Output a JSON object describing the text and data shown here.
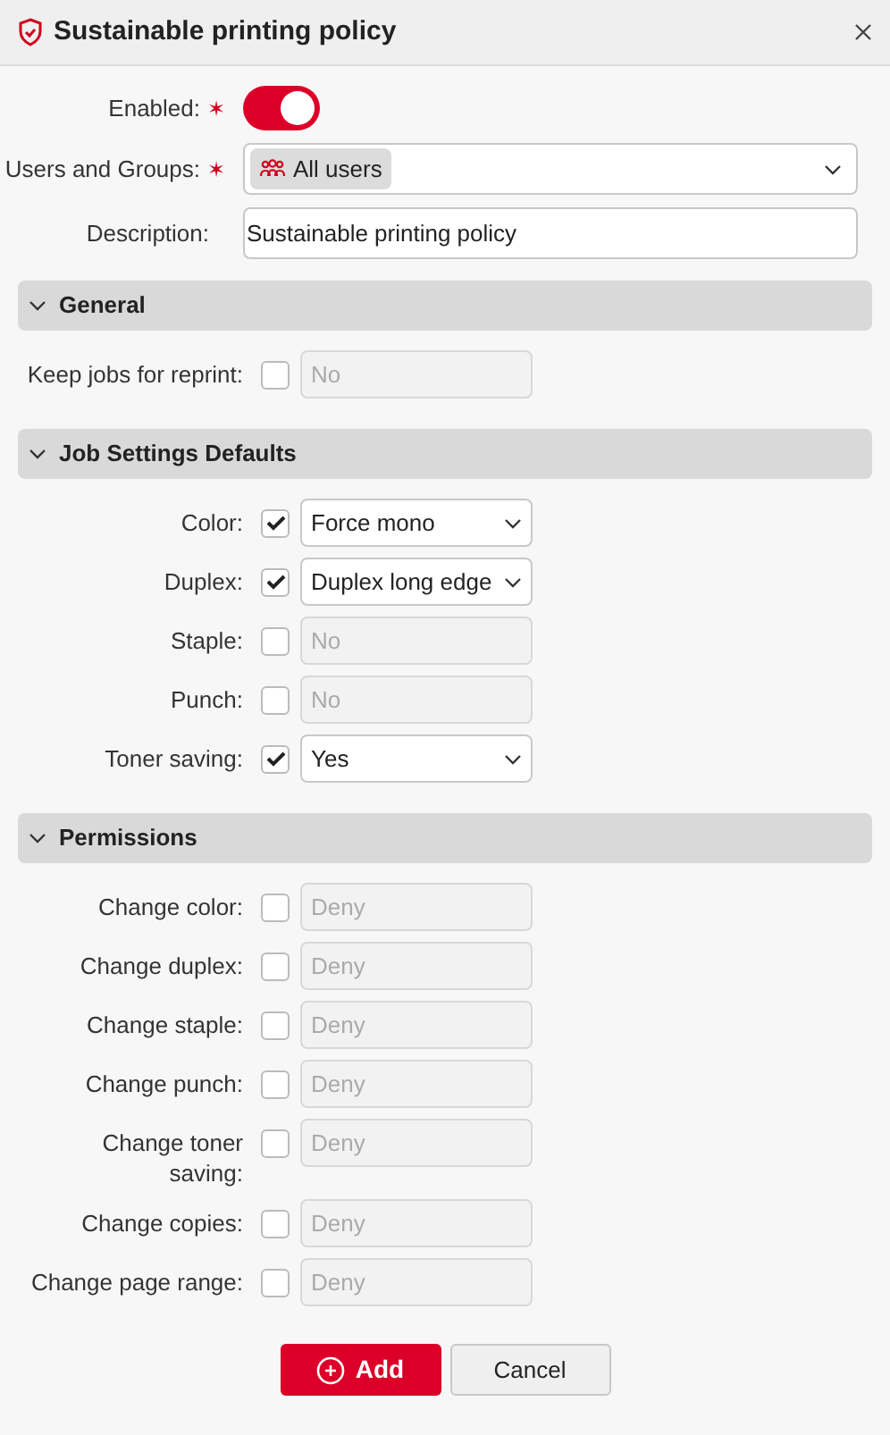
{
  "window": {
    "title": "Sustainable printing policy"
  },
  "form": {
    "enabled": {
      "label": "Enabled:",
      "on": true,
      "required_mark": "✶"
    },
    "users": {
      "label": "Users and Groups:",
      "required_mark": "✶",
      "tags": [
        "All users"
      ]
    },
    "description": {
      "label": "Description:",
      "value": "Sustainable printing policy"
    }
  },
  "sections": [
    {
      "title": "General",
      "expanded": true,
      "rows": [
        {
          "label": "Keep jobs for reprint:",
          "checked": false,
          "value": "No"
        }
      ]
    },
    {
      "title": "Job Settings Defaults",
      "expanded": true,
      "rows": [
        {
          "label": "Color:",
          "checked": true,
          "value": "Force mono"
        },
        {
          "label": "Duplex:",
          "checked": true,
          "value": "Duplex long edge"
        },
        {
          "label": "Staple:",
          "checked": false,
          "value": "No"
        },
        {
          "label": "Punch:",
          "checked": false,
          "value": "No"
        },
        {
          "label": "Toner saving:",
          "checked": true,
          "value": "Yes"
        }
      ]
    },
    {
      "title": "Permissions",
      "expanded": true,
      "rows": [
        {
          "label": "Change color:",
          "checked": false,
          "value": "Deny"
        },
        {
          "label": "Change duplex:",
          "checked": false,
          "value": "Deny"
        },
        {
          "label": "Change staple:",
          "checked": false,
          "value": "Deny"
        },
        {
          "label": "Change punch:",
          "checked": false,
          "value": "Deny"
        },
        {
          "label": "Change toner saving:",
          "checked": false,
          "value": "Deny"
        },
        {
          "label": "Change copies:",
          "checked": false,
          "value": "Deny"
        },
        {
          "label": "Change page range:",
          "checked": false,
          "value": "Deny"
        }
      ]
    }
  ],
  "buttons": [
    {
      "label": "Add",
      "kind": "primary"
    },
    {
      "label": "Cancel",
      "kind": "secondary"
    }
  ]
}
